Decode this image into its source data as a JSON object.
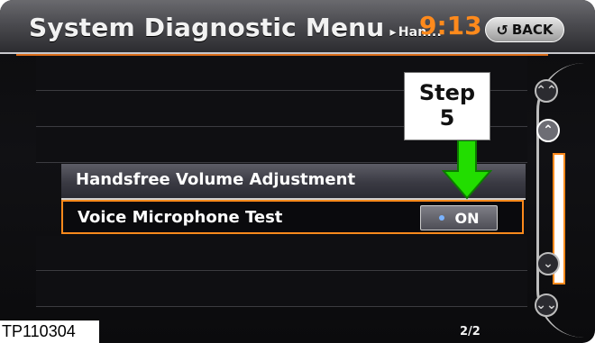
{
  "header": {
    "title": "System Diagnostic Menu",
    "crumb_arrow": "▸",
    "crumb": "Han...",
    "time": "9:13",
    "back_label": "BACK",
    "back_icon": "↺"
  },
  "menu": {
    "items": [
      {
        "label": "Handsfree Volume Adjustment"
      },
      {
        "label": "Voice Microphone Test",
        "toggle_label": "ON"
      }
    ]
  },
  "callout": {
    "line1": "Step",
    "line2": "5"
  },
  "scroll": {
    "page_top_icon": "⌃⌃",
    "page_up_icon": "⌃",
    "page_down_icon": "⌄",
    "page_bottom_icon": "⌄⌄",
    "page_indicator": "2/2"
  },
  "figure_label": "TP110304",
  "colors": {
    "accent": "#ff8a1c",
    "arrow_green": "#22dd00"
  }
}
